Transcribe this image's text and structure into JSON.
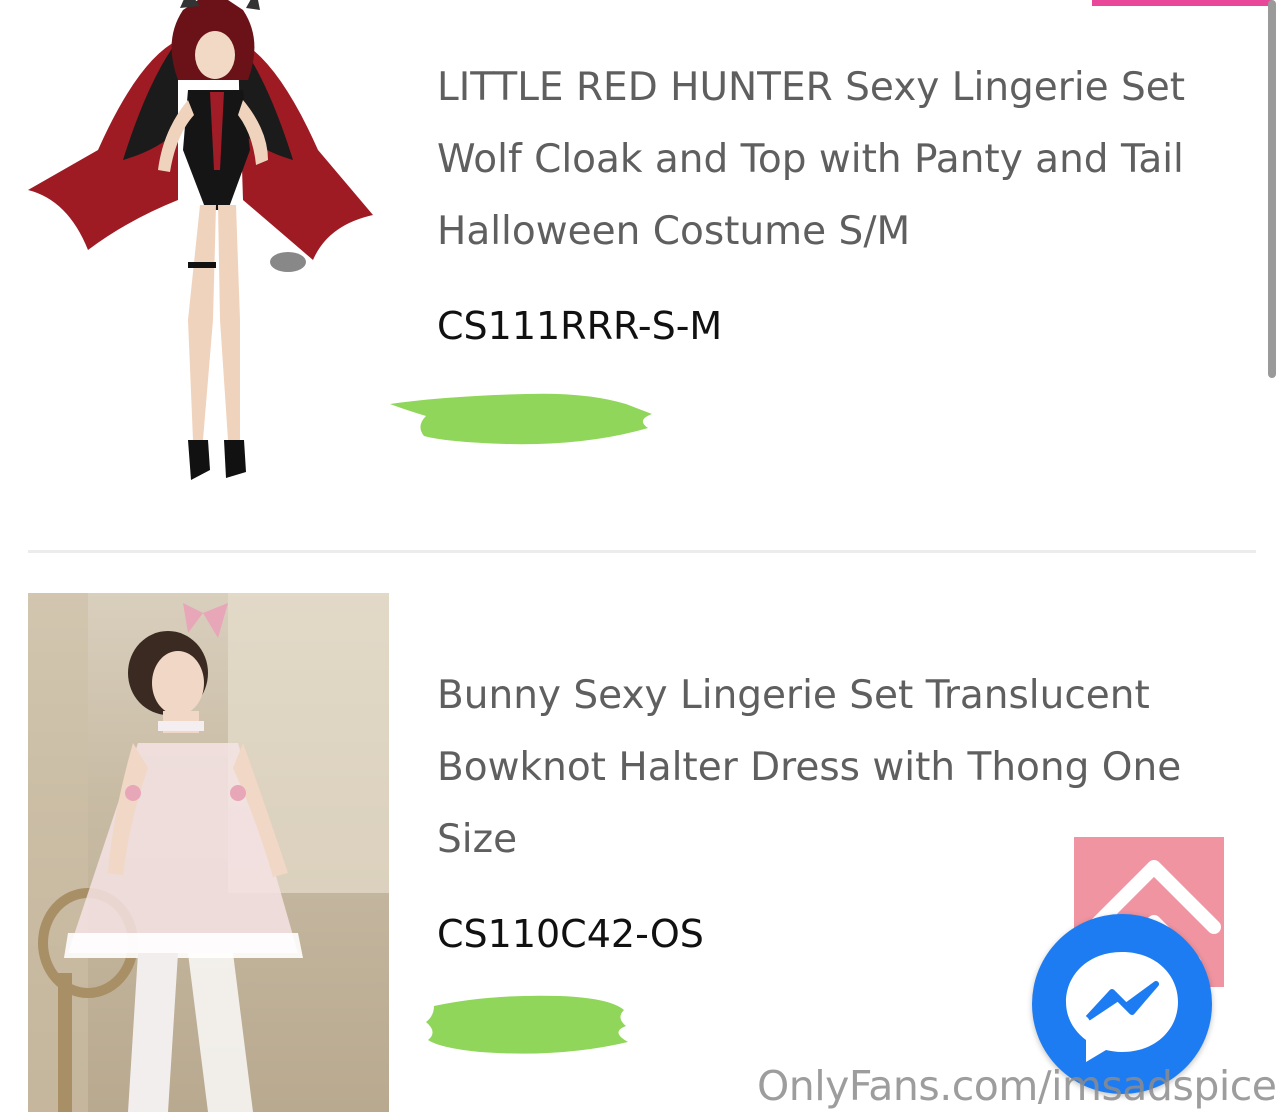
{
  "colors": {
    "accent_pink": "#e8479a",
    "title_text": "#5f5f5f",
    "sku_text": "#111111",
    "back_to_top_bg": "#ef94a0",
    "messenger_blue": "#1e7cf2",
    "redaction_green": "#8fd65a"
  },
  "products": [
    {
      "title_line_1": "LITTLE RED HUNTER Sexy Lingerie Set",
      "title_line_2": "Wolf Cloak and Top with Panty and Tail",
      "title_line_3": "Halloween Costume S/M",
      "sku": "CS111RRR-S-M",
      "image_icon": "costume-photo"
    },
    {
      "title_line_1": "Bunny Sexy Lingerie Set Translucent",
      "title_line_2": "Bowknot Halter Dress with Thong One",
      "title_line_3": "Size",
      "sku": "CS110C42-OS",
      "image_icon": "costume-photo"
    }
  ],
  "floating": {
    "back_to_top_icon": "chevron-up-icon",
    "messenger_icon": "messenger-icon"
  },
  "watermark": "OnlyFans.com/imsadspice"
}
